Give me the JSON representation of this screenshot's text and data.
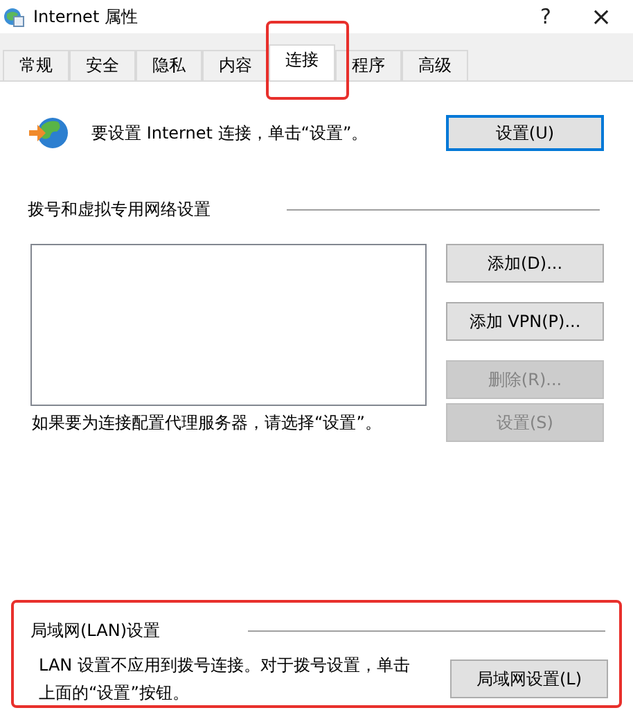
{
  "window": {
    "title": "Internet 属性",
    "help": "?",
    "close": "×"
  },
  "tabs": [
    {
      "label": "常规",
      "selected": false,
      "highlighted": false
    },
    {
      "label": "安全",
      "selected": false,
      "highlighted": false
    },
    {
      "label": "隐私",
      "selected": false,
      "highlighted": false
    },
    {
      "label": "内容",
      "selected": false,
      "highlighted": false
    },
    {
      "label": "连接",
      "selected": true,
      "highlighted": true
    },
    {
      "label": "程序",
      "selected": false,
      "highlighted": false
    },
    {
      "label": "高级",
      "selected": false,
      "highlighted": false
    }
  ],
  "setup": {
    "text": "要设置 Internet 连接，单击“设置”。",
    "button": {
      "label": "设置(U)",
      "disabled": false,
      "default": true
    }
  },
  "dialup": {
    "heading": "拨号和虚拟专用网络设置",
    "buttons": [
      {
        "label": "添加(D)...",
        "disabled": false
      },
      {
        "label": "添加 VPN(P)...",
        "disabled": false
      },
      {
        "label": "删除(R)...",
        "disabled": true
      }
    ],
    "proxy_text": "如果要为连接配置代理服务器，请选择“设置”。",
    "proxy_button": {
      "label": "设置(S)",
      "disabled": true
    }
  },
  "lan": {
    "heading": "局域网(LAN)设置",
    "text": "LAN 设置不应用到拨号连接。对于拨号设置，单击上面的“设置”按钮。",
    "button": {
      "label": "局域网设置(L)",
      "disabled": false
    },
    "highlighted": true
  }
}
